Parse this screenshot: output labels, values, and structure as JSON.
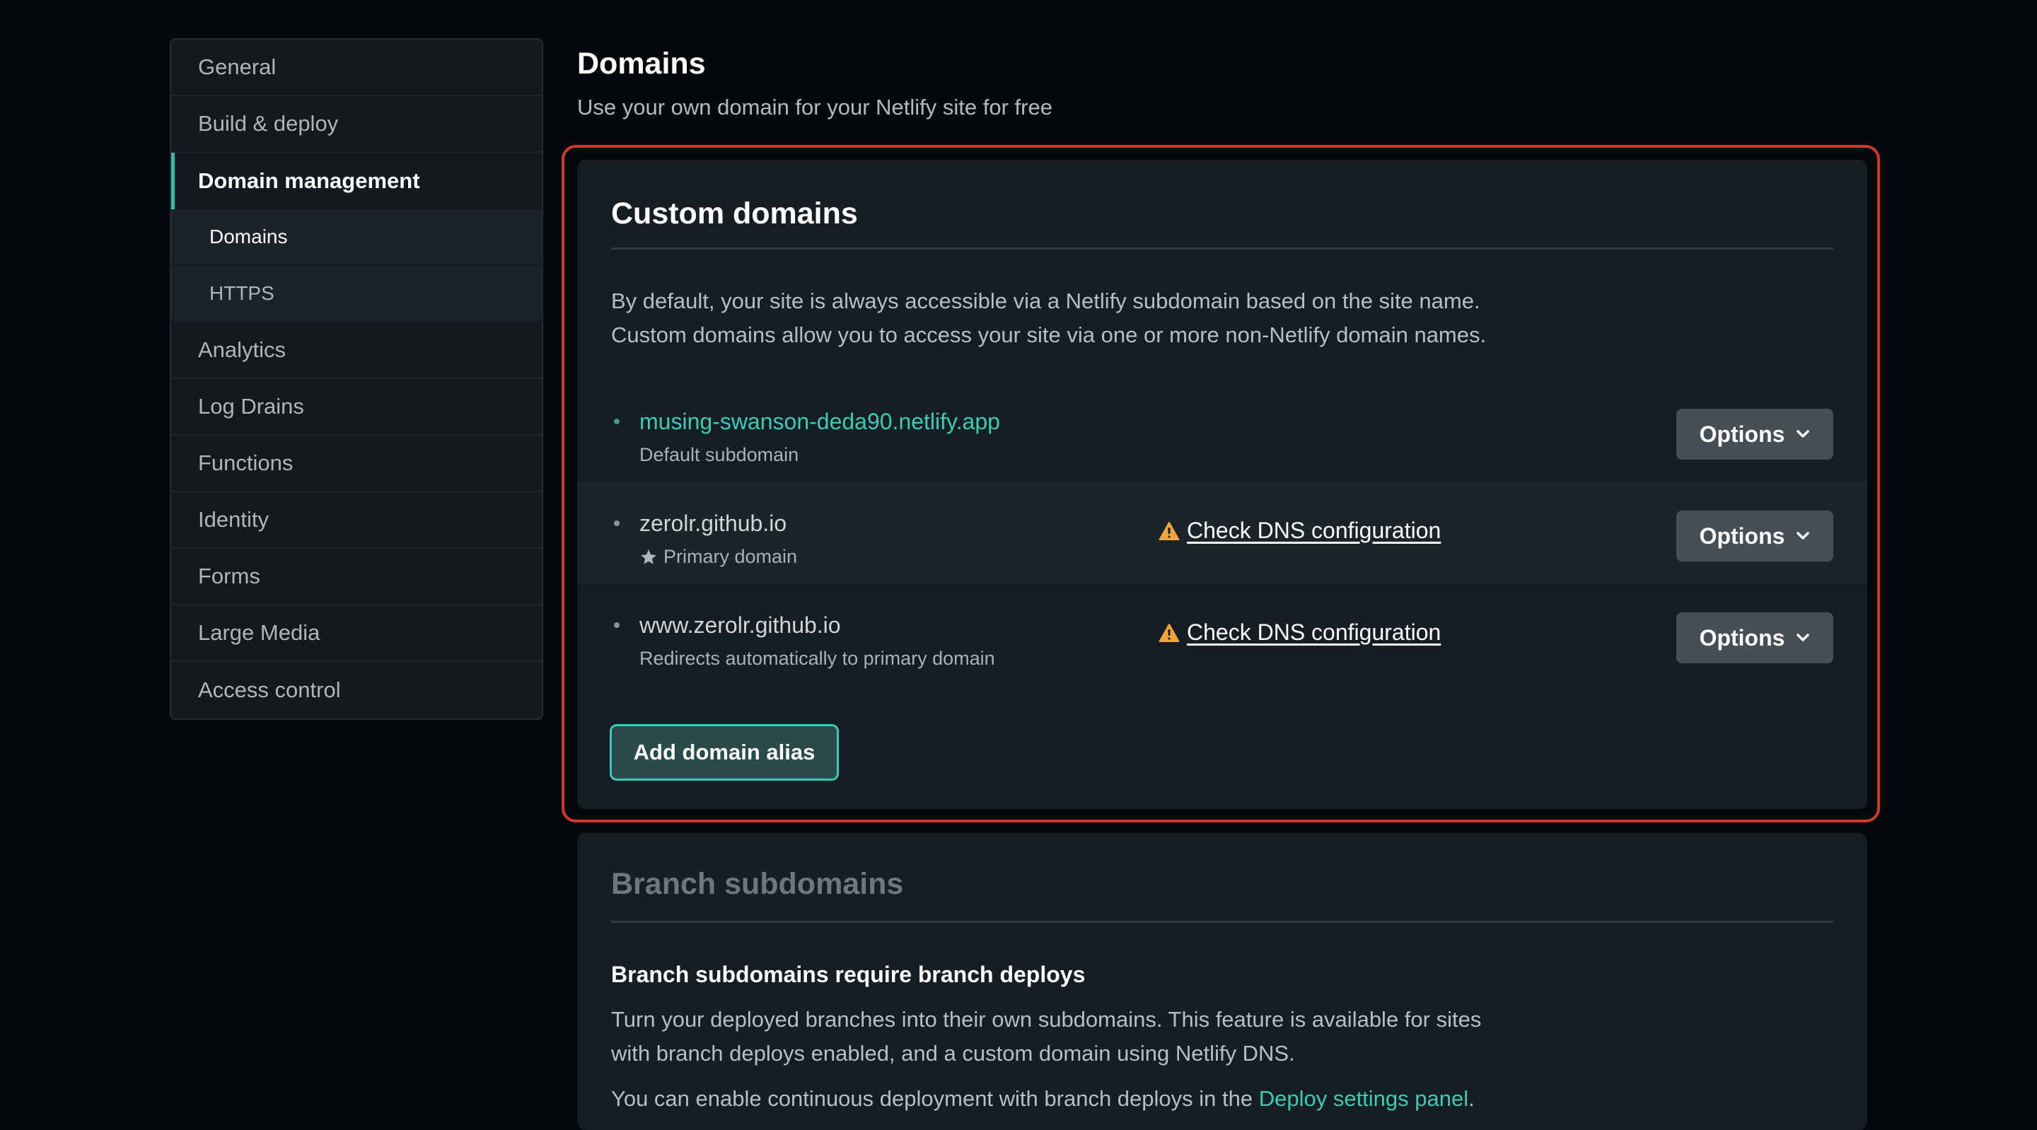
{
  "sidebar": {
    "items": [
      {
        "label": "General"
      },
      {
        "label": "Build & deploy"
      },
      {
        "label": "Domain management",
        "active": true
      },
      {
        "label": "Analytics"
      },
      {
        "label": "Log Drains"
      },
      {
        "label": "Functions"
      },
      {
        "label": "Identity"
      },
      {
        "label": "Forms"
      },
      {
        "label": "Large Media"
      },
      {
        "label": "Access control"
      }
    ],
    "subitems": [
      {
        "label": "Domains",
        "current": true
      },
      {
        "label": "HTTPS"
      }
    ]
  },
  "header": {
    "title": "Domains",
    "subtitle": "Use your own domain for your Netlify site for free"
  },
  "custom_domains": {
    "title": "Custom domains",
    "description_line1": "By default, your site is always accessible via a Netlify subdomain based on the site name.",
    "description_line2": "Custom domains allow you to access your site via one or more non-Netlify domain names.",
    "domains": [
      {
        "name": "musing-swanson-deda90.netlify.app",
        "sub": "Default subdomain",
        "options_label": "Options"
      },
      {
        "name": "zerolr.github.io",
        "sub": "Primary domain",
        "dns_label": "Check DNS configuration",
        "options_label": "Options"
      },
      {
        "name": "www.zerolr.github.io",
        "sub": "Redirects automatically to primary domain",
        "dns_label": "Check DNS configuration",
        "options_label": "Options"
      }
    ],
    "add_alias_label": "Add domain alias"
  },
  "branch_subdomains": {
    "title": "Branch subdomains",
    "heading": "Branch subdomains require branch deploys",
    "description_line1": "Turn your deployed branches into their own subdomains. This feature is available for sites",
    "description_line2": "with branch deploys enabled, and a custom domain using Netlify DNS.",
    "note_prefix": "You can enable continuous deployment with branch deploys in the ",
    "note_link": "Deploy settings panel",
    "note_suffix": "."
  },
  "colors": {
    "background": "#06090b",
    "card": "#161e23",
    "accent_teal": "#3ccbb7",
    "warning": "#f0a43b",
    "highlight_border": "#d0392b"
  },
  "icons": {
    "star": "star-icon",
    "warning": "warning-icon",
    "chevron": "chevron-down-icon"
  }
}
